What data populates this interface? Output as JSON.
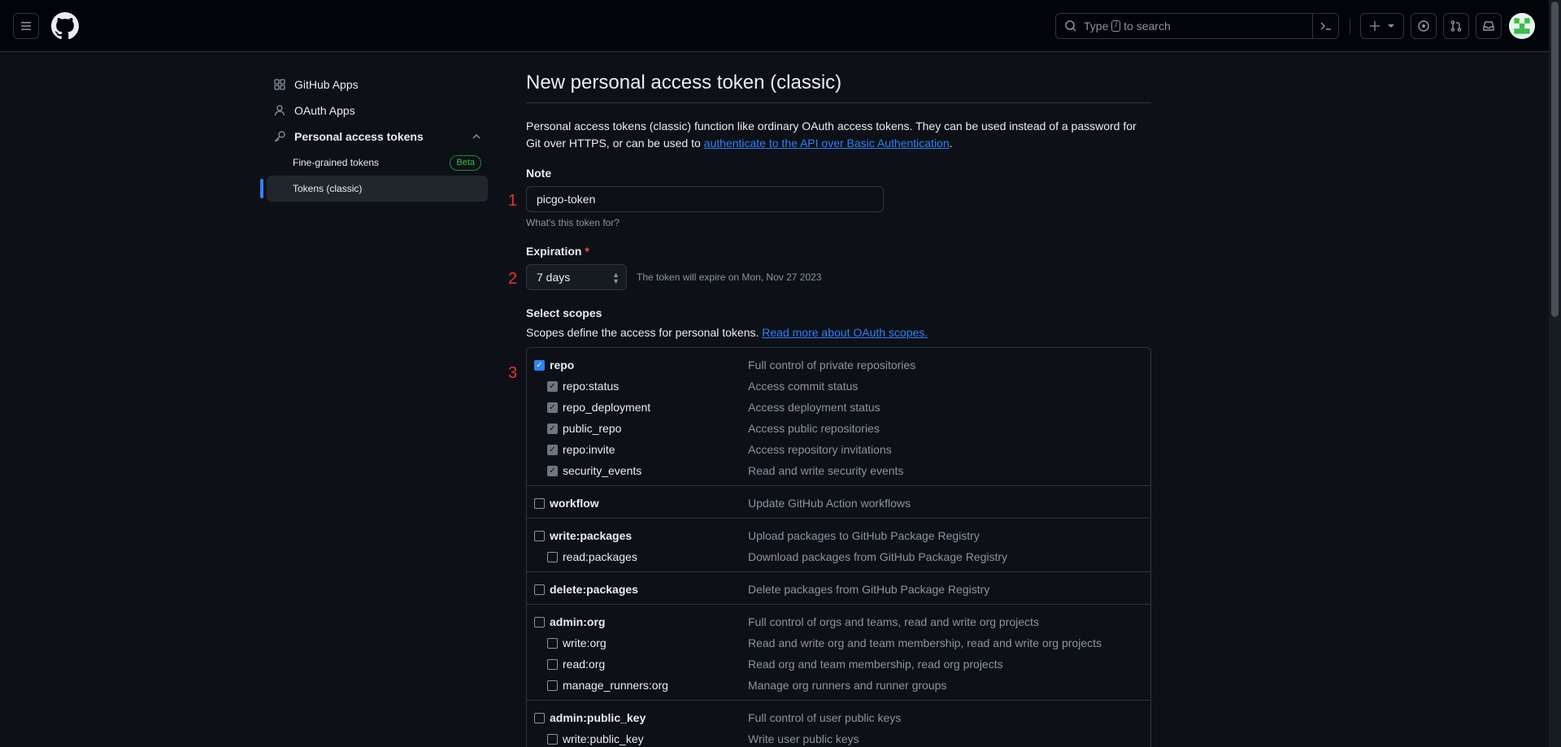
{
  "header": {
    "search_placeholder_pre": "Type",
    "search_slash": "/",
    "search_placeholder_post": "to search"
  },
  "sidebar": {
    "items": [
      {
        "label": "GitHub Apps",
        "icon": "apps-grid-icon"
      },
      {
        "label": "OAuth Apps",
        "icon": "person-icon"
      },
      {
        "label": "Personal access tokens",
        "icon": "key-icon"
      }
    ],
    "sub_items": [
      {
        "label": "Fine-grained tokens",
        "badge": "Beta"
      },
      {
        "label": "Tokens (classic)"
      }
    ]
  },
  "main": {
    "title": "New personal access token (classic)",
    "intro_text": "Personal access tokens (classic) function like ordinary OAuth access tokens. They can be used instead of a password for Git over HTTPS, or can be used to ",
    "intro_link": "authenticate to the API over Basic Authentication",
    "intro_end": ".",
    "note_label": "Note",
    "note_value": "picgo-token",
    "note_hint": "What's this token for?",
    "expiration_label": "Expiration",
    "expiration_required": "*",
    "expiration_value": "7 days",
    "expiration_note": "The token will expire on Mon, Nov 27 2023",
    "scopes_label": "Select scopes",
    "scopes_desc": "Scopes define the access for personal tokens. ",
    "scopes_link": "Read more about OAuth scopes."
  },
  "annotations": [
    "1",
    "2",
    "3"
  ],
  "scopes": [
    {
      "name": "repo",
      "desc": "Full control of private repositories",
      "checked": true,
      "children": [
        {
          "name": "repo:status",
          "desc": "Access commit status",
          "checked": true
        },
        {
          "name": "repo_deployment",
          "desc": "Access deployment status",
          "checked": true
        },
        {
          "name": "public_repo",
          "desc": "Access public repositories",
          "checked": true
        },
        {
          "name": "repo:invite",
          "desc": "Access repository invitations",
          "checked": true
        },
        {
          "name": "security_events",
          "desc": "Read and write security events",
          "checked": true
        }
      ]
    },
    {
      "name": "workflow",
      "desc": "Update GitHub Action workflows",
      "checked": false,
      "children": []
    },
    {
      "name": "write:packages",
      "desc": "Upload packages to GitHub Package Registry",
      "checked": false,
      "children": [
        {
          "name": "read:packages",
          "desc": "Download packages from GitHub Package Registry",
          "checked": false
        }
      ]
    },
    {
      "name": "delete:packages",
      "desc": "Delete packages from GitHub Package Registry",
      "checked": false,
      "children": []
    },
    {
      "name": "admin:org",
      "desc": "Full control of orgs and teams, read and write org projects",
      "checked": false,
      "children": [
        {
          "name": "write:org",
          "desc": "Read and write org and team membership, read and write org projects",
          "checked": false
        },
        {
          "name": "read:org",
          "desc": "Read org and team membership, read org projects",
          "checked": false
        },
        {
          "name": "manage_runners:org",
          "desc": "Manage org runners and runner groups",
          "checked": false
        }
      ]
    },
    {
      "name": "admin:public_key",
      "desc": "Full control of user public keys",
      "checked": false,
      "children": [
        {
          "name": "write:public_key",
          "desc": "Write user public keys",
          "checked": false
        }
      ]
    }
  ],
  "colors": {
    "accent": "#2f81f7",
    "background": "#0d1117",
    "annotation": "#e5342e"
  }
}
